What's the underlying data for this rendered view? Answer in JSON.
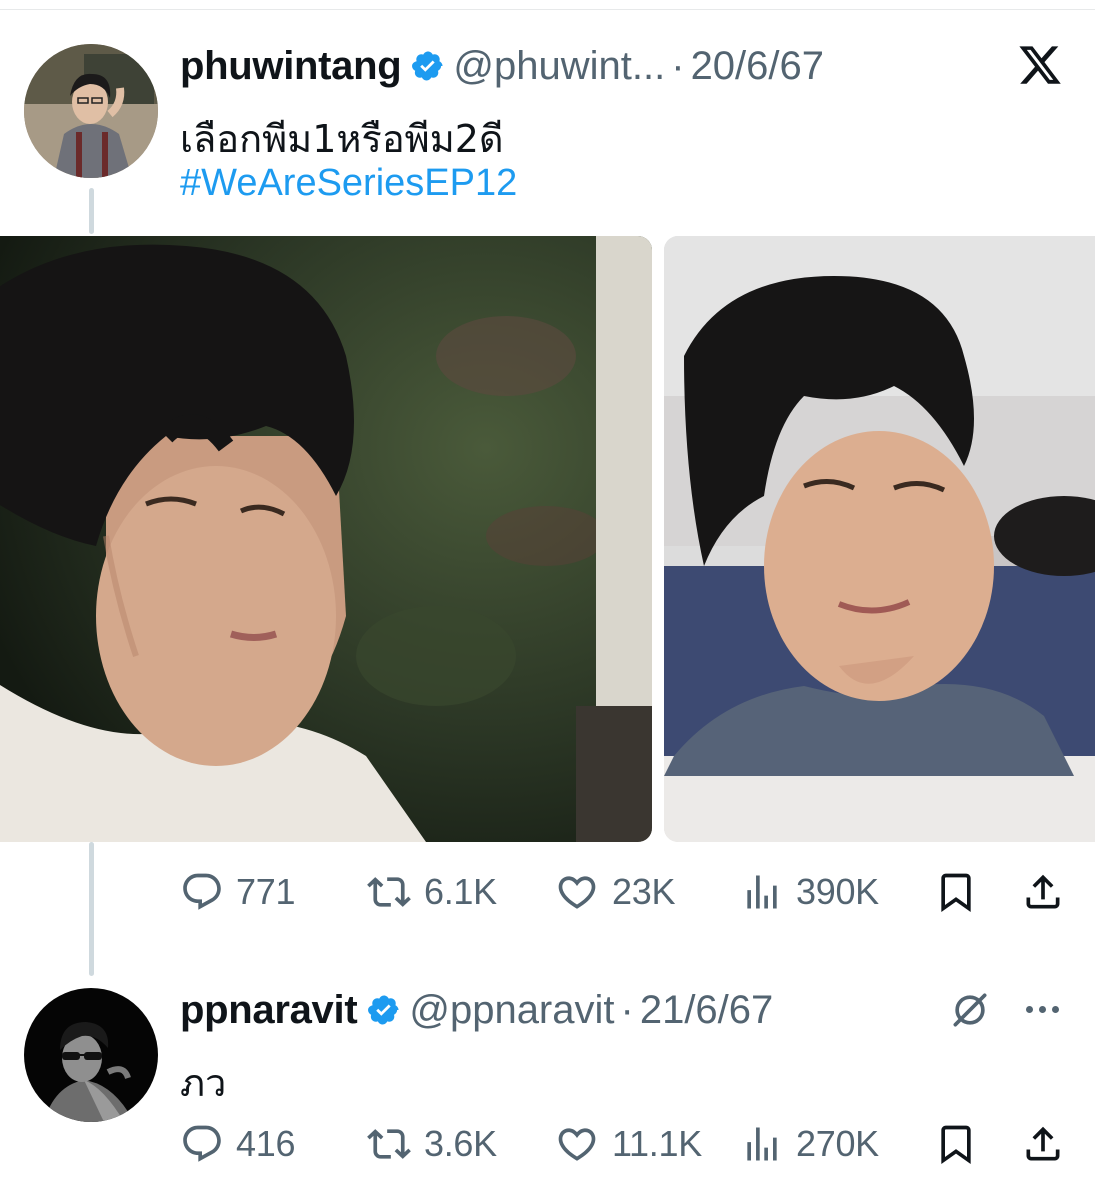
{
  "tweets": [
    {
      "display_name": "phuwintang",
      "handle": "@phuwint...",
      "separator": "·",
      "date": "20/6/67",
      "text": "เลือกพีม1หรือพีม2ดี",
      "hashtag": "#WeAreSeriesEP12",
      "stats": {
        "replies": "771",
        "reposts": "6.1K",
        "likes": "23K",
        "views": "390K"
      }
    },
    {
      "display_name": "ppnaravit",
      "handle": "@ppnaravit",
      "separator": "·",
      "date": "21/6/67",
      "text": "ภว",
      "stats": {
        "replies": "416",
        "reposts": "3.6K",
        "likes": "11.1K",
        "views": "270K"
      }
    }
  ],
  "colors": {
    "accent": "#1d9bf0",
    "text_primary": "#0f1419",
    "text_secondary": "#536471",
    "thread_line": "#cfd9de"
  },
  "icons": [
    "x-logo",
    "verified-badge",
    "reply-icon",
    "repost-icon",
    "like-icon",
    "views-icon",
    "bookmark-icon",
    "share-icon",
    "grok-icon",
    "more-icon"
  ]
}
